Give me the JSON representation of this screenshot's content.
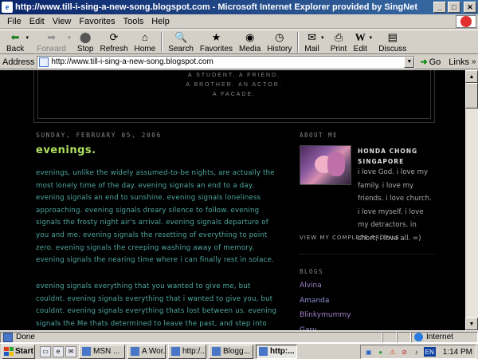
{
  "window": {
    "title": "http://www.till-i-sing-a-new-song.blogspot.com - Microsoft Internet Explorer provided by SingNet",
    "minimize": "0",
    "maximize": "1",
    "close": "r"
  },
  "menu": [
    "File",
    "Edit",
    "View",
    "Favorites",
    "Tools",
    "Help"
  ],
  "toolbar": {
    "back": "Back",
    "forward": "Forward",
    "stop": "Stop",
    "refresh": "Refresh",
    "home": "Home",
    "search": "Search",
    "favorites": "Favorites",
    "media": "Media",
    "history": "History",
    "mail": "Mail",
    "print": "Print",
    "edit": "Edit",
    "discuss": "Discuss"
  },
  "address": {
    "label": "Address",
    "url": "http://www.till-i-sing-a-new-song.blogspot.com",
    "go": "Go",
    "links": "Links"
  },
  "blog": {
    "description": [
      "A STUDENT. A FRIEND.",
      "A BROTHER. AN ACTOR.",
      "A FACADE."
    ],
    "date": "SUNDAY, FEBRUARY 05, 2006",
    "post_title": "evenings.",
    "para1": "evenings, unlike the widely assumed-to-be nights, are actually the most lonely time of the day. evening signals an end to a day. evening signals an end to sunshine. evening signals loneliness approaching. evening signals dreary silence to follow. evening signals the frosty night air's arrival. evening signals departure of you and me. evening signals the resetting of everything to point zero. evening signals the creeping washing away of memory. evening signals the nearing time where i can finally rest in solace.",
    "para2": "evening signals everything that you wanted to give me, but couldnt. evening signals everything that i wanted to give you, but couldnt. evening signals everything thats lost between us. evening signals the Me thats determined to leave the past, and step into the future.",
    "sidebar": {
      "about_heading": "ABOUT ME",
      "name": "HONDA CHONG SINGAPORE",
      "about_text": "i love God. i love my family. i love my friends. i love church. i love myself. i love my detractors. in short, i love all. =)",
      "profile_link": "VIEW MY COMPLETE PROFILE",
      "blogs_heading": "BLOGS",
      "blogs": [
        "Alvina",
        "Amanda",
        "Blinkymummy",
        "Gary"
      ]
    }
  },
  "status": {
    "text": "Done",
    "zone": "Internet"
  },
  "taskbar": {
    "start": "Start",
    "tasks": [
      "MSN ...",
      "A Wor...",
      "http:/...",
      "Blogg...",
      "http:..."
    ],
    "active_index": 4,
    "lang": "EN",
    "clock": "1:14 PM"
  },
  "colors": {
    "post_title": "#b0e060",
    "post_text": "#4ea8a0",
    "link": "#a080c8",
    "background": "#000000"
  }
}
